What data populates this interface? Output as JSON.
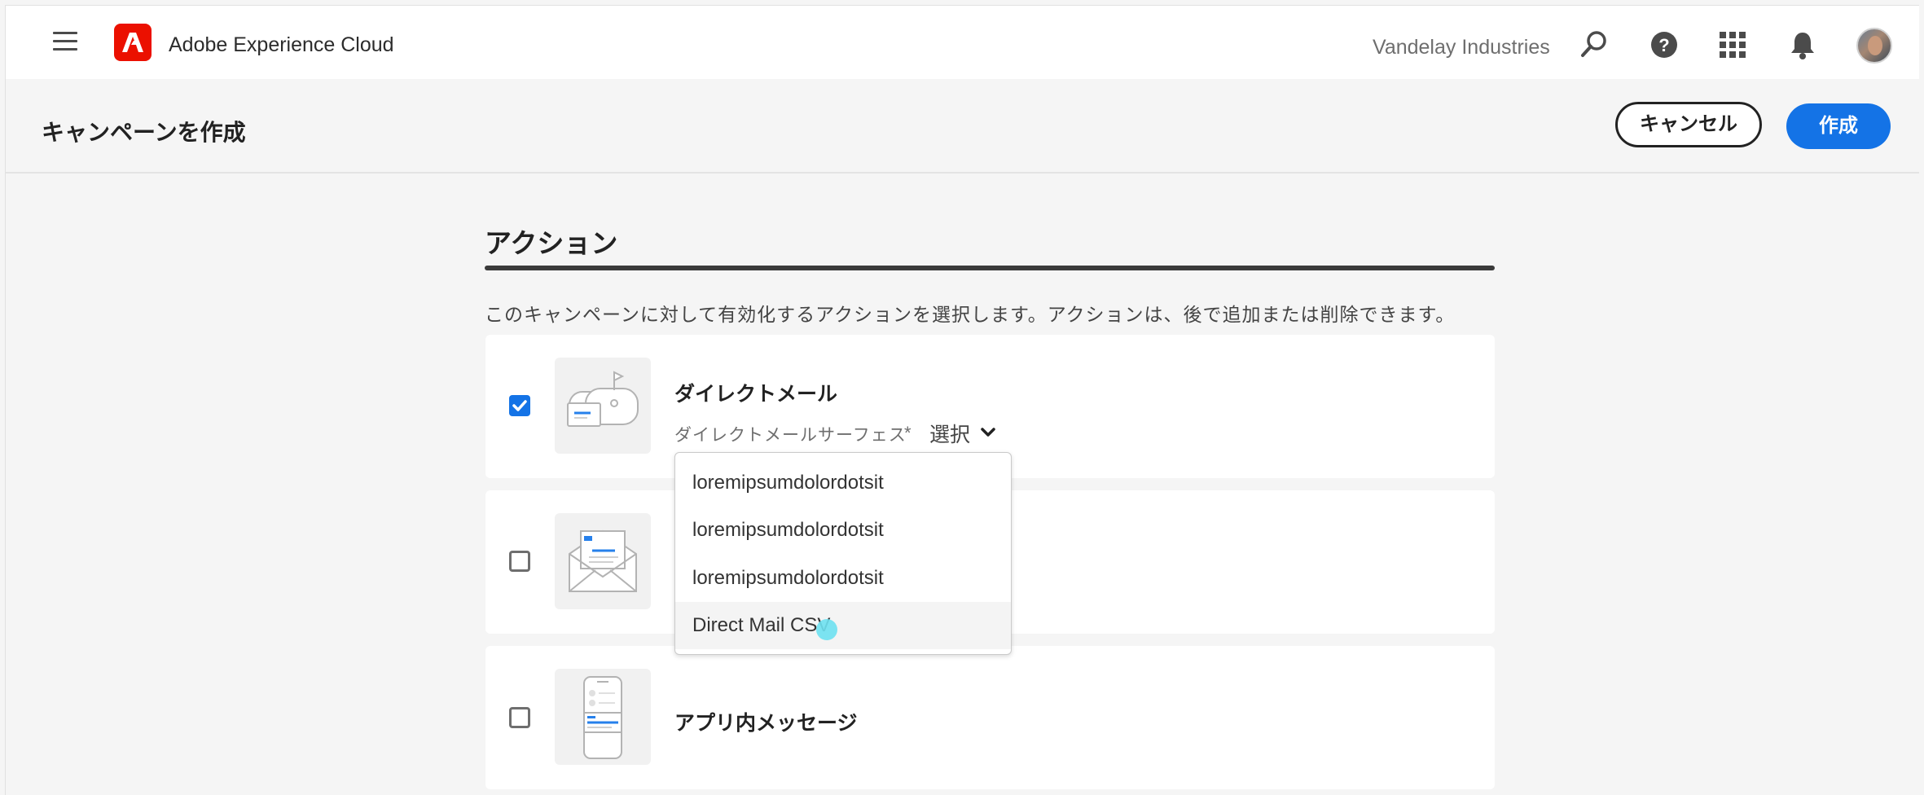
{
  "topbar": {
    "brand": "Adobe Experience Cloud",
    "org": "Vandelay Industries",
    "icons": [
      "menu-icon",
      "adobe-logo",
      "search-icon",
      "help-icon",
      "apps-grid-icon",
      "notification-bell-icon",
      "avatar"
    ]
  },
  "header": {
    "title": "キャンペーンを作成",
    "cancel_label": "キャンセル",
    "create_label": "作成"
  },
  "section": {
    "title": "アクション",
    "description": "このキャンペーンに対して有効化するアクションを選択します。アクションは、後で追加または削除できます。"
  },
  "actions": [
    {
      "title": "ダイレクトメール",
      "checked": true,
      "icon": "mailbox-icon",
      "field_label": "ダイレクトメールサーフェス",
      "required_mark": "*",
      "field_value": "選択"
    },
    {
      "title": "",
      "checked": false,
      "icon": "email-envelope-icon"
    },
    {
      "title": "アプリ内メッセージ",
      "checked": false,
      "icon": "mobile-in-app-icon"
    }
  ],
  "dropdown": {
    "options": [
      "loremipsumdolordotsit",
      "loremipsumdolordotsit",
      "loremipsumdolordotsit",
      "Direct Mail CSV"
    ],
    "hovered_index": 3
  },
  "colors": {
    "accent": "#1473e6",
    "adobe_red": "#eb1000",
    "cursor": "#6ee1f1"
  }
}
